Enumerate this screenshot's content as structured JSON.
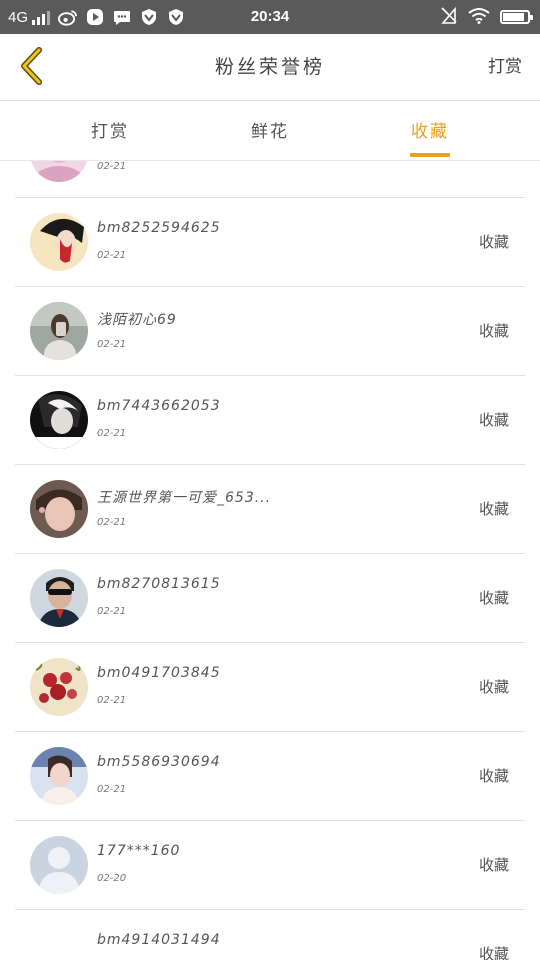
{
  "status_bar": {
    "network": "4G",
    "time": "20:34"
  },
  "nav": {
    "title": "粉丝荣誉榜",
    "action": "打赏"
  },
  "tabs": [
    {
      "label": "打赏",
      "active": false
    },
    {
      "label": "鲜花",
      "active": false
    },
    {
      "label": "收藏",
      "active": true
    }
  ],
  "accent_color": "#f0a015",
  "fans": [
    {
      "name": "",
      "date": "02-21",
      "action": ""
    },
    {
      "name": "bm8252594625",
      "date": "02-21",
      "action": "收藏"
    },
    {
      "name": "浅陌初心69",
      "date": "02-21",
      "action": "收藏"
    },
    {
      "name": "bm7443662053",
      "date": "02-21",
      "action": "收藏"
    },
    {
      "name": "王源世界第一可爱_653...",
      "date": "02-21",
      "action": "收藏"
    },
    {
      "name": "bm8270813615",
      "date": "02-21",
      "action": "收藏"
    },
    {
      "name": "bm0491703845",
      "date": "02-21",
      "action": "收藏"
    },
    {
      "name": "bm5586930694",
      "date": "02-21",
      "action": "收藏"
    },
    {
      "name": "177***160",
      "date": "02-20",
      "action": "收藏"
    },
    {
      "name": "bm4914031494",
      "date": "",
      "action": "收藏"
    }
  ]
}
